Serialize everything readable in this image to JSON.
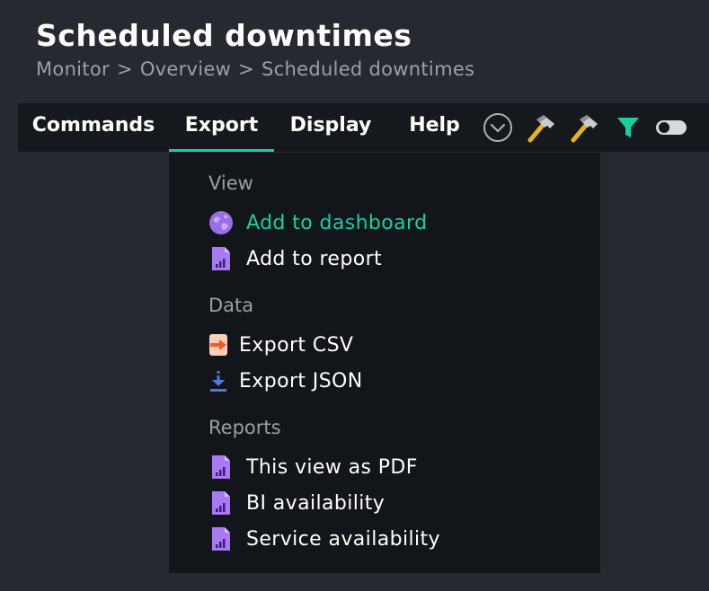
{
  "page": {
    "title": "Scheduled downtimes",
    "breadcrumb": [
      "Monitor",
      "Overview",
      "Scheduled downtimes"
    ],
    "breadcrumb_separator": ">"
  },
  "menubar": {
    "items": [
      {
        "label": "Commands",
        "active": false
      },
      {
        "label": "Export",
        "active": true
      },
      {
        "label": "Display",
        "active": false
      },
      {
        "label": "Help",
        "active": false
      }
    ],
    "icons": [
      "chevron-down-circle-icon",
      "hammer-icon",
      "hammer-icon",
      "filter-icon",
      "toggle-switch-icon"
    ],
    "accent_color": "#15d1a0"
  },
  "dropdown": {
    "sections": [
      {
        "heading": "View",
        "items": [
          {
            "label": "Add to dashboard",
            "icon": "globe-icon",
            "highlighted": true
          },
          {
            "label": "Add to report",
            "icon": "report-document-icon"
          }
        ]
      },
      {
        "heading": "Data",
        "items": [
          {
            "label": "Export CSV",
            "icon": "csv-export-icon"
          },
          {
            "label": "Export JSON",
            "icon": "download-icon"
          }
        ]
      },
      {
        "heading": "Reports",
        "items": [
          {
            "label": "This view as PDF",
            "icon": "report-document-icon"
          },
          {
            "label": "BI availability",
            "icon": "report-document-icon"
          },
          {
            "label": "Service availability",
            "icon": "report-document-icon"
          }
        ]
      }
    ]
  },
  "colors": {
    "background": "#262a30",
    "menubar_bg": "#15191e",
    "dropdown_bg": "#121519",
    "muted_text": "#9aa0a6",
    "highlight": "#15d1a0",
    "report_icon": "#a97af2"
  }
}
